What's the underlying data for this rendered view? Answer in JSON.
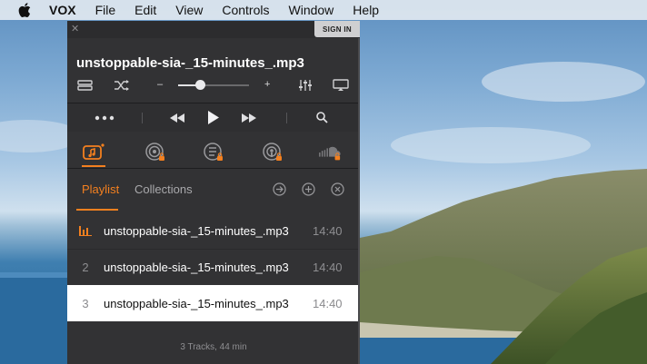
{
  "menubar": {
    "apple_icon": "apple-icon",
    "items": [
      "VOX",
      "File",
      "Edit",
      "View",
      "Controls",
      "Window",
      "Help"
    ]
  },
  "window": {
    "sign_in_label": "SIGN IN",
    "track_title": "unstoppable-sia-_15-minutes_.mp3",
    "controls": {
      "repeat_icon": "repeat-icon",
      "shuffle_icon": "shuffle-icon",
      "volume_minus": "–",
      "volume_plus": "+",
      "volume_level": 0.32,
      "equalizer_icon": "equalizer-icon",
      "airplay_icon": "airplay-icon"
    },
    "transport": {
      "more_icon": "more-icon",
      "prev_icon": "rewind-icon",
      "play_icon": "play-icon",
      "next_icon": "fast-forward-icon",
      "search_icon": "search-icon"
    },
    "sources": [
      "music-library-icon",
      "radio-icon",
      "podcast-list-icon",
      "podcast-icon",
      "soundcloud-icon"
    ],
    "list_tabs": {
      "playlist": "Playlist",
      "collections": "Collections"
    },
    "list_actions": [
      "arrow-circle-icon",
      "add-circle-icon",
      "clear-circle-icon"
    ],
    "tracks": [
      {
        "number": "",
        "playing": true,
        "name": "unstoppable-sia-_15-minutes_.mp3",
        "duration": "14:40"
      },
      {
        "number": "2",
        "playing": false,
        "name": "unstoppable-sia-_15-minutes_.mp3",
        "duration": "14:40"
      },
      {
        "number": "3",
        "playing": false,
        "name": "unstoppable-sia-_15-minutes_.mp3",
        "duration": "14:40"
      }
    ],
    "footer": "3 Tracks, 44 min"
  },
  "colors": {
    "accent": "#f4801f",
    "window_bg": "#323234",
    "selected_row": "#ffffff"
  }
}
